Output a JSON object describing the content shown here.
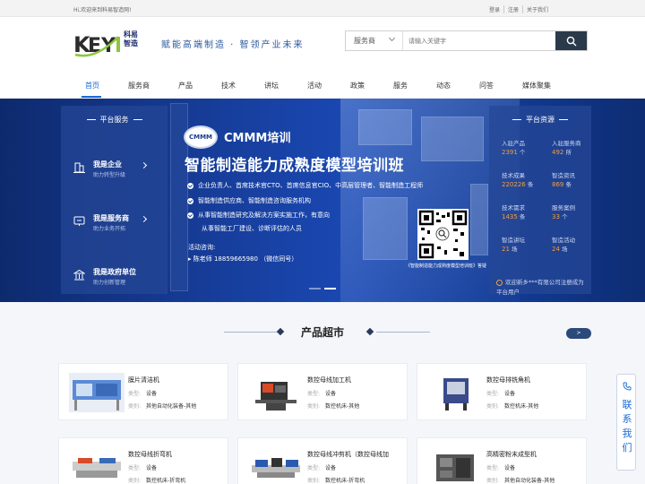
{
  "topbar": {
    "welcome": "Hi,欢迎来到科易智造网!",
    "links": [
      "登录",
      "注册",
      "关于我们"
    ]
  },
  "logo": {
    "text_line1": "科易",
    "text_line2": "智造"
  },
  "slogan": "赋能高端制造 · 智领产业未来",
  "search": {
    "category": "服务商",
    "placeholder": "请输入关键字"
  },
  "nav": {
    "items": [
      "首页",
      "服务商",
      "产品",
      "技术",
      "讲坛",
      "活动",
      "政策",
      "服务",
      "动态",
      "问答",
      "媒体聚集"
    ],
    "active": 0
  },
  "banner": {
    "left_panel": {
      "title": "平台服务",
      "items": [
        {
          "title": "我是企业",
          "sub": "助力转型升级"
        },
        {
          "title": "我是服务商",
          "sub": "助力业务开拓"
        },
        {
          "title": "我是政府单位",
          "sub": "助力创新管理"
        }
      ]
    },
    "center": {
      "logo_text": "CMMM",
      "heading": "CMMM培训",
      "title": "智能制造能力成熟度模型培训班",
      "bullets": [
        "企业负责人、首席技术官CTO、首席信息官CIO、中高层管理者、智能制造工程师",
        "智能制造供应商、智能制造咨询服务机构",
        "从事智能制造研究及解决方案实施工作，有意向"
      ],
      "bullet_cont": "从事智能工厂建设、诊断评估的人员",
      "contact_label": "活动咨询:",
      "contact": "陈老师 18859665980 （微信同号）",
      "qr_caption": "《智能制造能力成熟度模型培训班》答疑"
    },
    "right_panel": {
      "title": "平台资源",
      "stats": [
        {
          "label": "入驻产品",
          "value": "2391",
          "unit": "个"
        },
        {
          "label": "入驻服务商",
          "value": "492",
          "unit": "所"
        },
        {
          "label": "技术成果",
          "value": "220226",
          "unit": "条"
        },
        {
          "label": "智造资讯",
          "value": "869",
          "unit": "条"
        },
        {
          "label": "技术需求",
          "value": "1435",
          "unit": "条"
        },
        {
          "label": "服务案例",
          "value": "33",
          "unit": "个"
        },
        {
          "label": "智造讲坛",
          "value": "21",
          "unit": "场"
        },
        {
          "label": "智造活动",
          "value": "24",
          "unit": "场"
        }
      ],
      "notice": "欢迎新乡***有限公司注册成为平台用户"
    }
  },
  "section": {
    "title": "产品超市",
    "more": ">"
  },
  "products": [
    {
      "name": "膜片清洁机",
      "type_label": "类型:",
      "type": "设备",
      "cat_label": "类别:",
      "cat": "其他自动化装备-其他"
    },
    {
      "name": "数控母线加工机",
      "type_label": "类型:",
      "type": "设备",
      "cat_label": "类别:",
      "cat": "数控机床-其他"
    },
    {
      "name": "数控母排铣角机",
      "type_label": "类型:",
      "type": "设备",
      "cat_label": "类别:",
      "cat": "数控机床-其他"
    },
    {
      "name": "数控母线折弯机",
      "type_label": "类型:",
      "type": "设备",
      "cat_label": "类别:",
      "cat": "数控机床-折弯机"
    },
    {
      "name": "数控母线冲剪机（数控母线加",
      "type_label": "类型:",
      "type": "设备",
      "cat_label": "类别:",
      "cat": "数控机床-折弯机"
    },
    {
      "name": "高精密粉末成型机",
      "type_label": "类型:",
      "type": "设备",
      "cat_label": "类别:",
      "cat": "其他自动化装备-其他"
    }
  ],
  "float_contact": {
    "text": "联系我们"
  },
  "colors": {
    "primary": "#1769d8",
    "banner": "#1a48b3",
    "accent": "#f0a040"
  }
}
